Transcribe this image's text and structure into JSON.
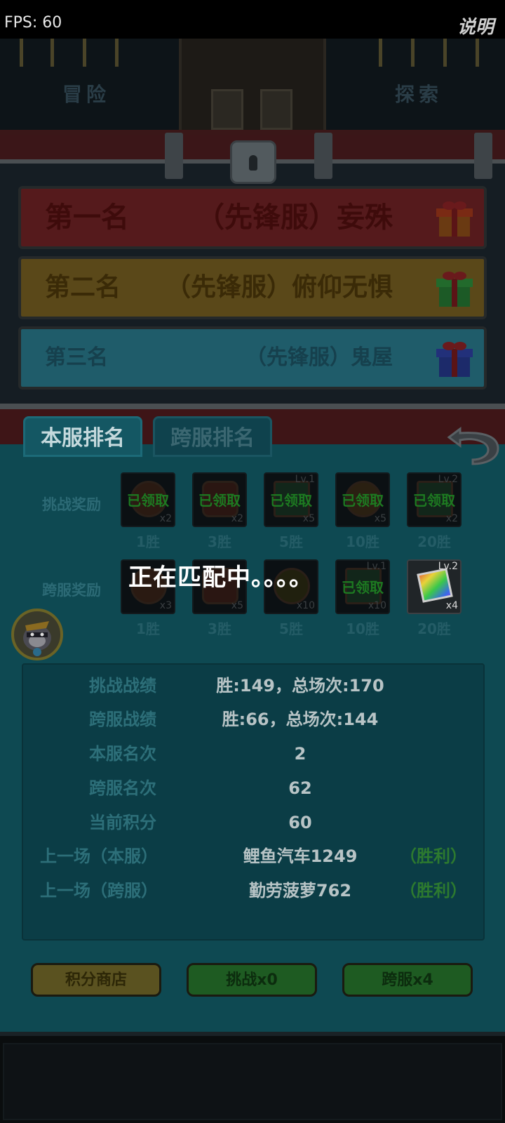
{
  "hud": {
    "left_mode": "冒险",
    "right_mode": "探索",
    "fps_label": "FPS: 60",
    "help_label": "说明"
  },
  "leaderboard": {
    "rows": [
      {
        "rank": "第一名",
        "name": "（先锋服）妄殊"
      },
      {
        "rank": "第二名",
        "name": "（先锋服）俯仰无惧"
      },
      {
        "rank": "第三名",
        "name": "（先锋服）鬼屋"
      }
    ]
  },
  "tabs": {
    "local": "本服排名",
    "cross": "跨服排名"
  },
  "rewards": {
    "challenge_label": "挑战奖励",
    "cross_label": "跨服奖励",
    "challenge_slots": [
      {
        "status": "已领取",
        "qty": "x2",
        "lv": "",
        "wins": "1胜"
      },
      {
        "status": "已领取",
        "qty": "x2",
        "lv": "",
        "wins": "3胜"
      },
      {
        "status": "已领取",
        "qty": "x5",
        "lv": "Lv.1",
        "wins": "5胜"
      },
      {
        "status": "已领取",
        "qty": "x5",
        "lv": "",
        "wins": "10胜"
      },
      {
        "status": "已领取",
        "qty": "x2",
        "lv": "Lv.2",
        "wins": "20胜"
      }
    ],
    "cross_slots": [
      {
        "status": "",
        "qty": "x3",
        "lv": "",
        "wins": "1胜"
      },
      {
        "status": "",
        "qty": "x5",
        "lv": "",
        "wins": "3胜"
      },
      {
        "status": "",
        "qty": "x10",
        "lv": "",
        "wins": "5胜"
      },
      {
        "status": "已领取",
        "qty": "x10",
        "lv": "Lv.1",
        "wins": "10胜"
      },
      {
        "status": "",
        "qty": "x4",
        "lv": "Lv.2",
        "wins": "20胜"
      }
    ]
  },
  "matching_text": "正在匹配中。。。。",
  "stats": {
    "challenge_record_label": "挑战战绩",
    "challenge_record_value": "胜:149，总场次:170",
    "cross_record_label": "跨服战绩",
    "cross_record_value": "胜:66，总场次:144",
    "local_rank_label": "本服名次",
    "local_rank_value": "2",
    "cross_rank_label": "跨服名次",
    "cross_rank_value": "62",
    "points_label": "当前积分",
    "points_value": "60",
    "last_local_label": "上一场（本服）",
    "last_local_opponent": "鲤鱼汽车1249",
    "last_local_result": "（胜利）",
    "last_cross_label": "上一场（跨服）",
    "last_cross_opponent": "勤劳菠萝762",
    "last_cross_result": "（胜利）"
  },
  "buttons": {
    "shop": "积分商店",
    "challenge": "挑战x0",
    "cross": "跨服x4"
  },
  "colors": {
    "panel_bg": "#0e4952",
    "first_place": "#551a1c",
    "second_place": "#5a4819",
    "third_place": "#1f5c6a",
    "claimed_green": "#1d7a21"
  }
}
